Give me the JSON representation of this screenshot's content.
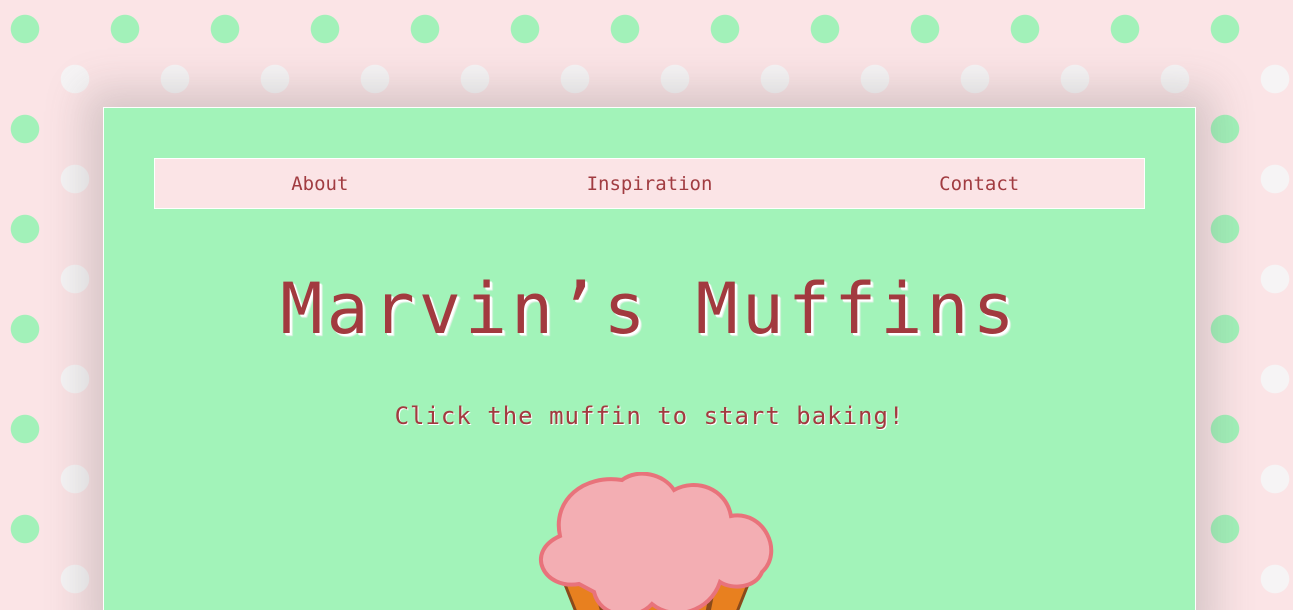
{
  "nav": {
    "items": [
      {
        "label": "About"
      },
      {
        "label": "Inspiration"
      },
      {
        "label": "Contact"
      }
    ]
  },
  "header": {
    "title": "Marvin’s Muffins",
    "subtitle": "Click the muffin to start baking!"
  },
  "muffin": {
    "icon": "muffin-icon"
  },
  "colors": {
    "page_bg": "#fbe4e6",
    "dot_green": "#a2f1b9",
    "dot_white": "#f6f4f5",
    "card_bg": "#a2f3b9",
    "text": "#a23a3f",
    "frosting": "#f3aeb3",
    "frosting_outline": "#e8737b",
    "wrapper": "#e8801f",
    "wrapper_stripe": "#8a4a1a"
  }
}
